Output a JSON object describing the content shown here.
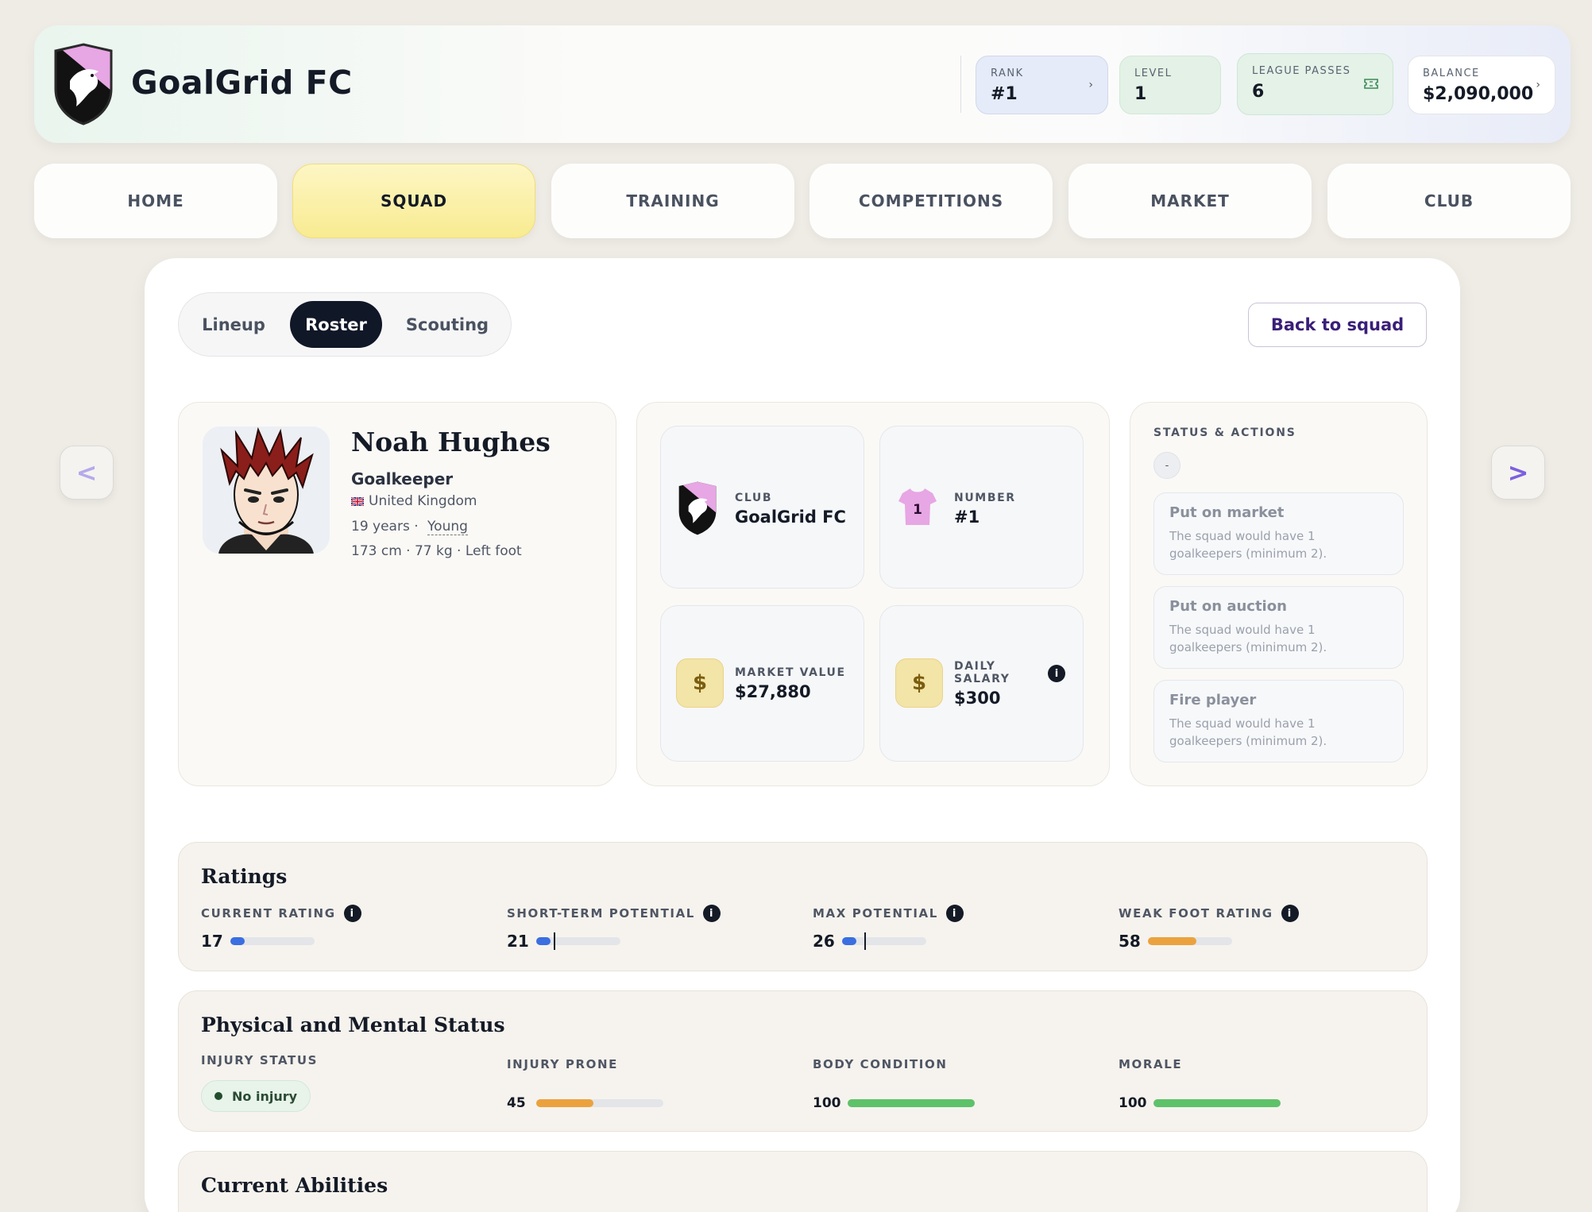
{
  "header": {
    "club_name": "GoalGrid FC",
    "stats": {
      "rank": {
        "label": "RANK",
        "value": "#1"
      },
      "level": {
        "label": "LEVEL",
        "value": "1"
      },
      "league_passes": {
        "label": "LEAGUE PASSES",
        "value": "6"
      },
      "balance": {
        "label": "BALANCE",
        "value": "$2,090,000"
      }
    },
    "chevron": "›",
    "crest_colors": {
      "pink": "#e7a6e4",
      "black": "#121212"
    }
  },
  "nav": {
    "items": [
      {
        "label": "HOME",
        "active": false
      },
      {
        "label": "SQUAD",
        "active": true
      },
      {
        "label": "TRAINING",
        "active": false
      },
      {
        "label": "COMPETITIONS",
        "active": false
      },
      {
        "label": "MARKET",
        "active": false
      },
      {
        "label": "CLUB",
        "active": false
      }
    ]
  },
  "tabs": {
    "items": [
      "Lineup",
      "Roster",
      "Scouting"
    ],
    "active": "Roster",
    "back_label": "Back to squad"
  },
  "pager": {
    "prev": "<",
    "next": ">"
  },
  "player": {
    "name": "Noah Hughes",
    "position": "Goalkeeper",
    "country": "United Kingdom",
    "age": "19 years ·",
    "age_group": "Young",
    "physical": "173 cm · 77 kg · Left foot"
  },
  "info": {
    "club": {
      "label": "CLUB",
      "value": "GoalGrid FC"
    },
    "number": {
      "label": "NUMBER",
      "value": "#1",
      "shirt_number": "1"
    },
    "market_value": {
      "label": "MARKET VALUE",
      "value": "$27,880"
    },
    "daily_salary": {
      "label_line1": "DAILY",
      "label_line2": "SALARY",
      "value": "$300"
    },
    "currency_icon": "$",
    "info_icon": "i"
  },
  "status": {
    "title": "STATUS & ACTIONS",
    "indicator": "-",
    "actions": [
      {
        "title": "Put on market",
        "desc": "The squad would have 1 goalkeepers (minimum 2)."
      },
      {
        "title": "Put on auction",
        "desc": "The squad would have 1 goalkeepers (minimum 2)."
      },
      {
        "title": "Fire player",
        "desc": "The squad would have 1 goalkeepers (minimum 2)."
      }
    ]
  },
  "ratings": {
    "title": "Ratings",
    "items": [
      {
        "label": "CURRENT RATING",
        "value": "17",
        "percent": 17,
        "color": "#3b6ee0"
      },
      {
        "label": "SHORT-TERM POTENTIAL",
        "value": "21",
        "percent": 17,
        "marker_percent": 21,
        "color": "#3b6ee0"
      },
      {
        "label": "MAX POTENTIAL",
        "value": "26",
        "percent": 17,
        "marker_percent": 26,
        "color": "#3b6ee0"
      },
      {
        "label": "WEAK FOOT RATING",
        "value": "58",
        "percent": 58,
        "color": "#eba23e"
      }
    ]
  },
  "physical": {
    "title": "Physical and Mental Status",
    "injury_status_label": "INJURY STATUS",
    "injury_status_value": "No injury",
    "items": [
      {
        "label": "INJURY PRONE",
        "value": "45",
        "percent": 45,
        "color": "#eba23e"
      },
      {
        "label": "BODY CONDITION",
        "value": "100",
        "percent": 100,
        "color": "#5ec26a"
      },
      {
        "label": "MORALE",
        "value": "100",
        "percent": 100,
        "color": "#5ec26a"
      }
    ]
  },
  "abilities": {
    "title": "Current Abilities"
  }
}
